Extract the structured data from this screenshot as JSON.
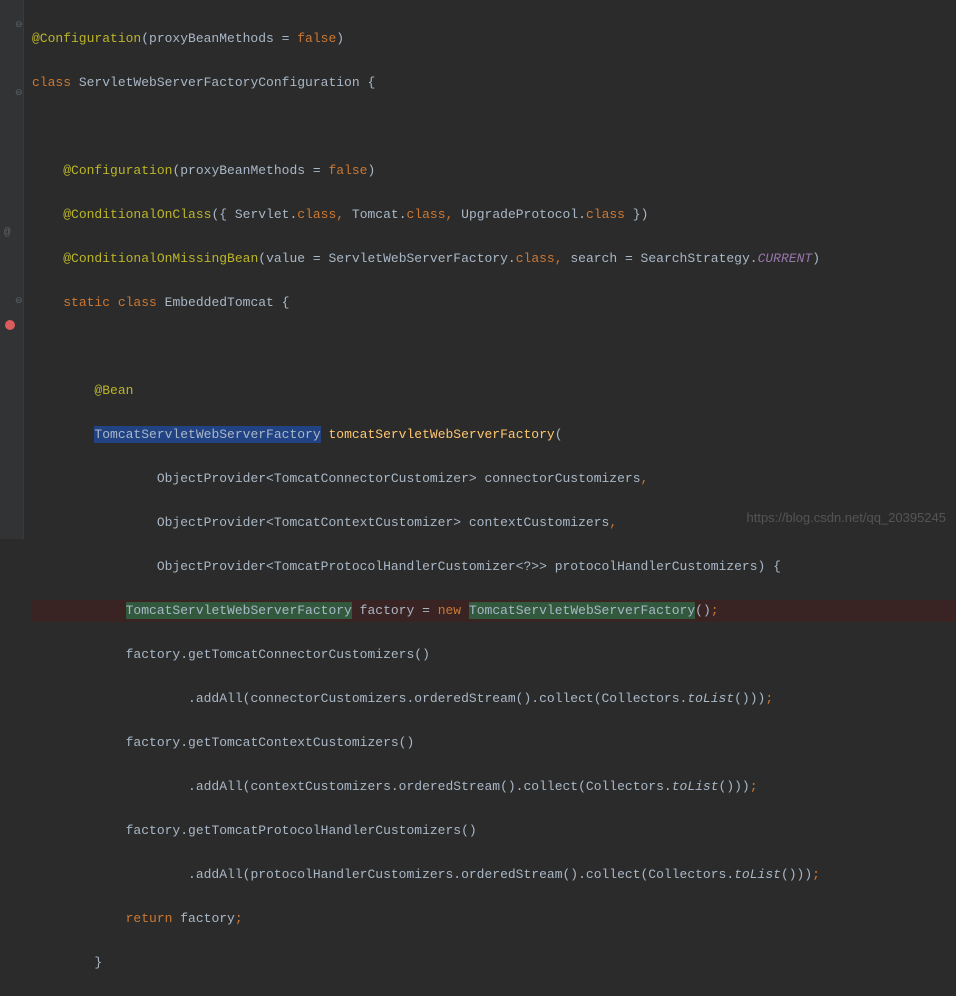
{
  "code": {
    "line1_anno": "@Configuration",
    "line1_rest": "(proxyBeanMethods = ",
    "line1_false": "false",
    "line1_end": ")",
    "line2_kw": "class ",
    "line2_name": "ServletWebServerFactoryConfiguration {",
    "line4_anno": "@Configuration",
    "line4_rest": "(proxyBeanMethods = ",
    "line4_false": "false",
    "line4_end": ")",
    "line5_anno": "@ConditionalOnClass",
    "line5_rest": "({ Servlet.",
    "line5_class": "class",
    "line5_c1": ", ",
    "line5_t": "Tomcat.",
    "line5_c2": ", ",
    "line5_u": "UpgradeProtocol.",
    "line5_end": " })",
    "line6_anno": "@ConditionalOnMissingBean",
    "line6_rest": "(value = ServletWebServerFactory.",
    "line6_c1": ", ",
    "line6_s": "search = SearchStrategy.",
    "line6_cur": "CURRENT",
    "line6_end": ")",
    "line7_static": "static ",
    "line7_class": "class ",
    "line7_name": "EmbeddedTomcat {",
    "line9_anno": "@Bean",
    "line10_type": "TomcatServletWebServerFactory",
    "line10_method": " tomcatServletWebServerFactory",
    "line10_paren": "(",
    "line11": "ObjectProvider<TomcatConnectorCustomizer> connectorCustomizers",
    "line11_comma": ",",
    "line12": "ObjectProvider<TomcatContextCustomizer> contextCustomizers",
    "line12_comma": ",",
    "line13": "ObjectProvider<TomcatProtocolHandlerCustomizer<?>> protocolHandlerCustomizers) {",
    "line14_type1": "TomcatServletWebServerFactory",
    "line14_mid": " factory = ",
    "line14_new": "new ",
    "line14_type2": "TomcatServletWebServerFactory",
    "line14_end": "()",
    "line14_semi": ";",
    "line15": "factory.getTomcatConnectorCustomizers()",
    "line16_a": ".addAll(connectorCustomizers.orderedStream().collect(Collectors.",
    "line16_tolist": "toList",
    "line16_end": "()))",
    "line16_semi": ";",
    "line17": "factory.getTomcatContextCustomizers()",
    "line18_a": ".addAll(contextCustomizers.orderedStream().collect(Collectors.",
    "line18_tolist": "toList",
    "line18_end": "()))",
    "line18_semi": ";",
    "line19": "factory.getTomcatProtocolHandlerCustomizers()",
    "line20_a": ".addAll(protocolHandlerCustomizers.orderedStream().collect(Collectors.",
    "line20_tolist": "toList",
    "line20_end": "()))",
    "line20_semi": ";",
    "line21_ret": "return ",
    "line21_var": "factory",
    "line21_semi": ";",
    "line22": "}"
  },
  "watermark": "https://blog.csdn.net/qq_20395245"
}
